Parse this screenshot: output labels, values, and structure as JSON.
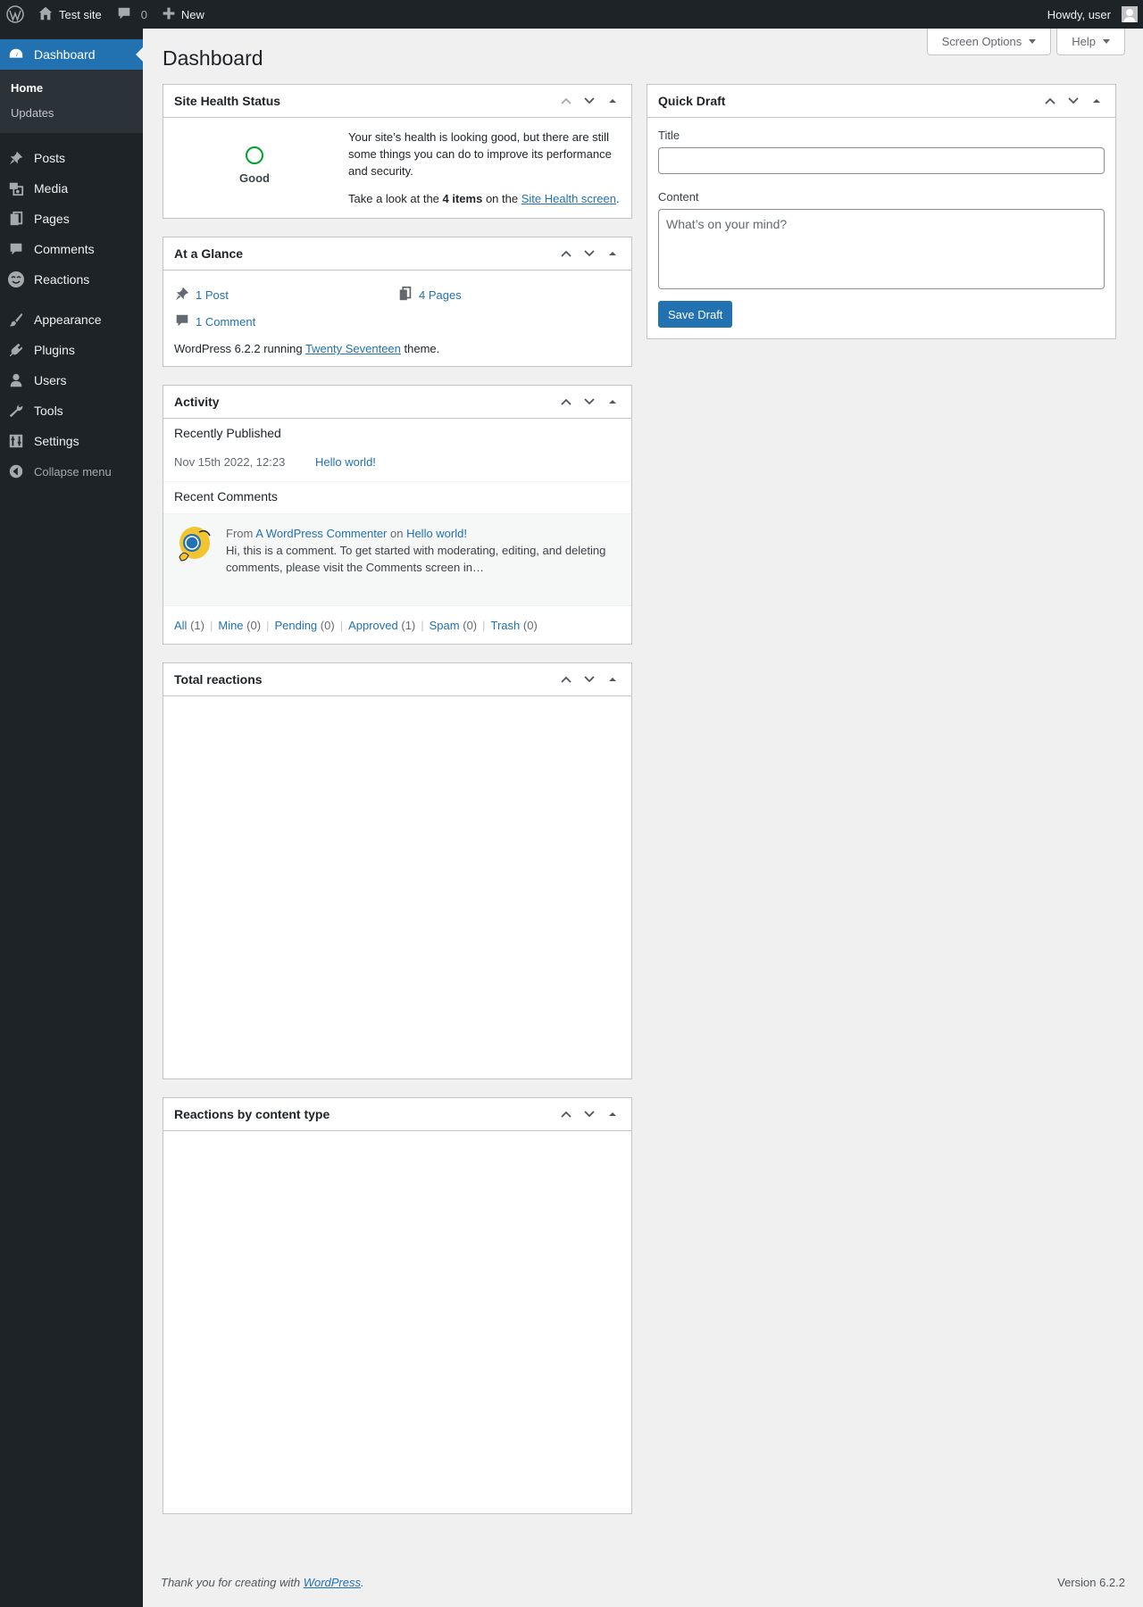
{
  "adminbar": {
    "site_name": "Test site",
    "comments_count": "0",
    "new_label": "New",
    "howdy": "Howdy, user"
  },
  "sidebar": {
    "dashboard": "Dashboard",
    "submenu": [
      "Home",
      "Updates"
    ],
    "items": [
      "Posts",
      "Media",
      "Pages",
      "Comments",
      "Reactions"
    ],
    "items2": [
      "Appearance",
      "Plugins",
      "Users",
      "Tools",
      "Settings"
    ],
    "collapse": "Collapse menu"
  },
  "header": {
    "title": "Dashboard",
    "screen_options": "Screen Options",
    "help": "Help"
  },
  "site_health": {
    "title": "Site Health Status",
    "status": "Good",
    "message": "Your site’s health is looking good, but there are still some things you can do to improve its performance and security.",
    "look_pre": "Take a look at the ",
    "items": "4 items",
    "look_mid": " on the ",
    "link": "Site Health screen",
    "period": "."
  },
  "glance": {
    "title": "At a Glance",
    "posts": "1 Post",
    "pages": "4 Pages",
    "comments": "1 Comment",
    "version_pre": "WordPress 6.2.2 running ",
    "theme": "Twenty Seventeen",
    "version_post": " theme."
  },
  "activity": {
    "title": "Activity",
    "recently_published": "Recently Published",
    "date": "Nov 15th 2022, 12:23",
    "post_link": "Hello world!",
    "recent_comments": "Recent Comments",
    "from": "From ",
    "commenter": "A WordPress Commenter",
    "on": " on ",
    "comment_post": "Hello world!",
    "comment_body": "Hi, this is a comment. To get started with moderating, editing, and deleting comments, please visit the Comments screen in…",
    "filters": [
      {
        "label": "All",
        "count": "(1)"
      },
      {
        "label": "Mine",
        "count": "(0)"
      },
      {
        "label": "Pending",
        "count": "(0)"
      },
      {
        "label": "Approved",
        "count": "(1)"
      },
      {
        "label": "Spam",
        "count": "(0)"
      },
      {
        "label": "Trash",
        "count": "(0)"
      }
    ]
  },
  "total_reactions": {
    "title": "Total reactions"
  },
  "reactions_by_type": {
    "title": "Reactions by content type"
  },
  "quick_draft": {
    "title": "Quick Draft",
    "title_label": "Title",
    "content_label": "Content",
    "content_placeholder": "What’s on your mind?",
    "save": "Save Draft"
  },
  "footer": {
    "thanks_pre": "Thank you for creating with ",
    "wp_link": "WordPress",
    "thanks_post": ".",
    "version": "Version 6.2.2"
  },
  "colors": {
    "accent": "#2271b1",
    "adminbar_bg": "#1d2327",
    "health_good": "#00a32a"
  }
}
